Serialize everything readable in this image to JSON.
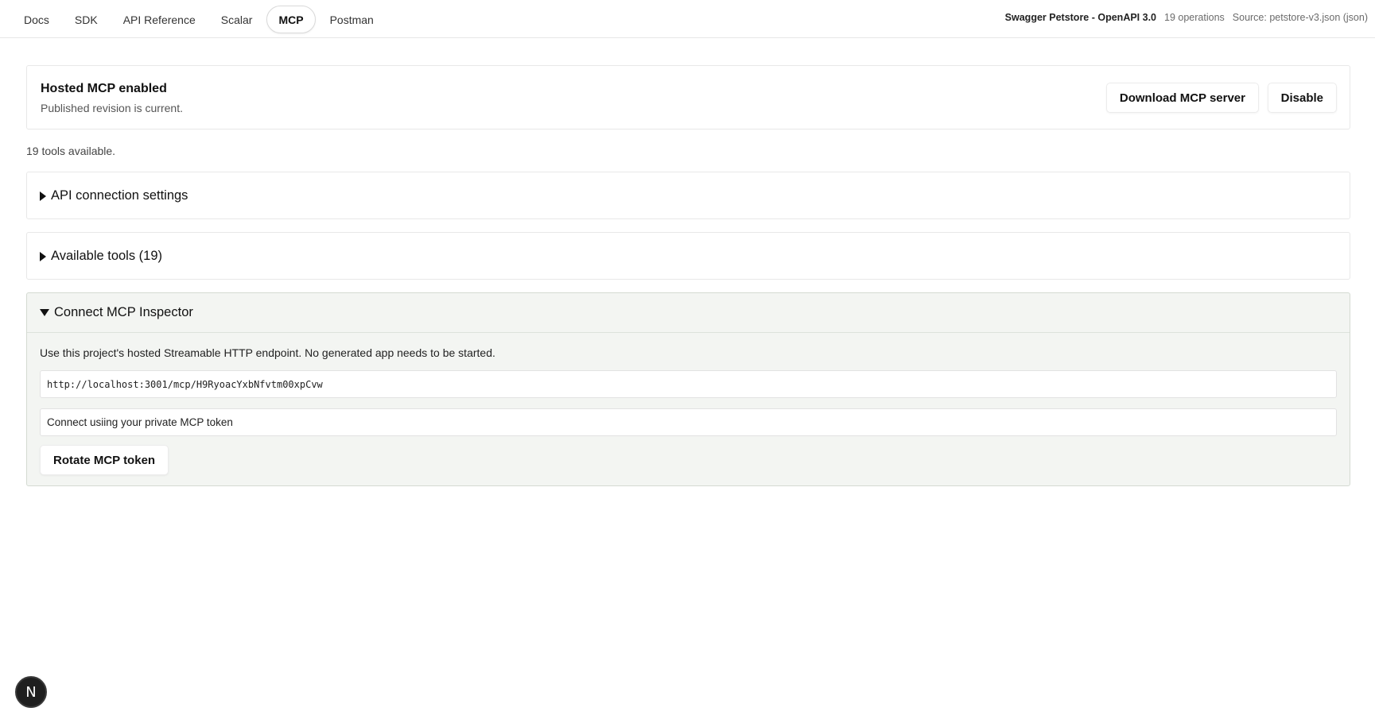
{
  "nav": {
    "tabs": [
      {
        "label": "Docs"
      },
      {
        "label": "SDK"
      },
      {
        "label": "API Reference"
      },
      {
        "label": "Scalar"
      },
      {
        "label": "MCP"
      },
      {
        "label": "Postman"
      }
    ],
    "active_tab": "MCP"
  },
  "spec": {
    "title": "Swagger Petstore - OpenAPI 3.0",
    "operations": "19 operations",
    "source": "Source: petstore-v3.json (json)"
  },
  "status": {
    "title": "Hosted MCP enabled",
    "subtitle": "Published revision is current.",
    "download_label": "Download MCP server",
    "disable_label": "Disable"
  },
  "tools_count": "19 tools available.",
  "sections": {
    "api_connection": "API connection settings",
    "available_tools": "Available tools (19)"
  },
  "inspector": {
    "title": "Connect MCP Inspector",
    "description": "Use this project's hosted Streamable HTTP endpoint. No generated app needs to be started.",
    "endpoint_url": "http://localhost:3001/mcp/H9RyoacYxbNfvtm00xpCvw",
    "token_text": "Connect usiing your private MCP token",
    "rotate_label": "Rotate MCP token"
  },
  "badge": {
    "letter": "N"
  },
  "icons": {
    "collapsed": "caret-right-icon",
    "expanded": "caret-down-icon"
  }
}
